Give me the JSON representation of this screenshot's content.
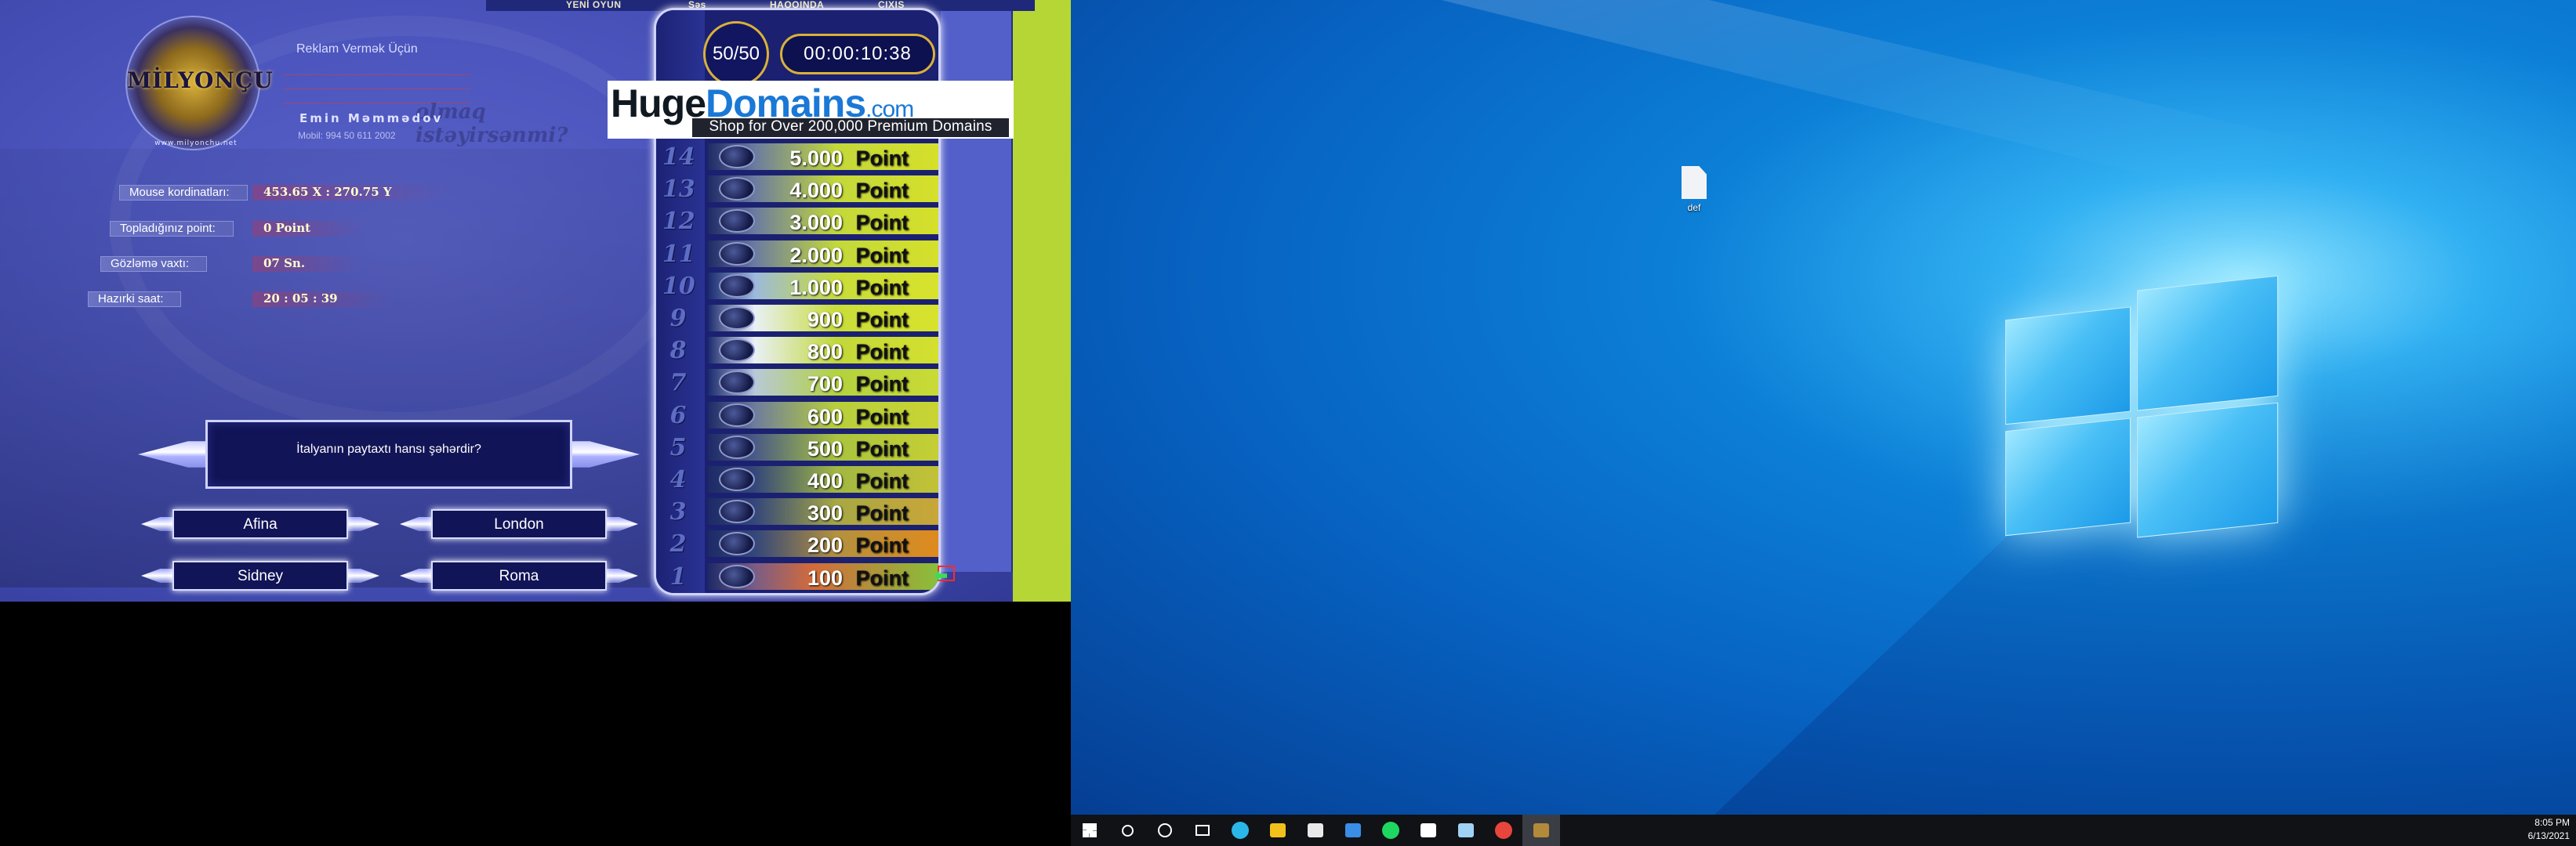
{
  "game": {
    "menu": {
      "new_game": "YENİ OYUN",
      "sound": "Səs",
      "about": "HAQQINDA",
      "exit": "ÇIXIŞ"
    },
    "logo": {
      "text": "MİLYONÇU",
      "site": "www.milyonchu.net"
    },
    "ad": {
      "title": "Reklam Vermək Üçün",
      "faint": "olmaq istəyirsənmi?",
      "name": "Emin Məmmədov",
      "phone": "Mobil: 994 50 611 2002"
    },
    "stats": [
      {
        "label": "Mouse kordinatları:",
        "value": "453.65 X : 270.75 Y"
      },
      {
        "label": "Topladığınız point:",
        "value": "0 Point"
      },
      {
        "label": "Gözləmə vaxtı:",
        "value": "07 Sn."
      },
      {
        "label": "Hazırki saat:",
        "value": "20 : 05 : 39"
      }
    ],
    "question": "İtalyanın paytaxtı hansı şəhərdir?",
    "answers": [
      "Afina",
      "London",
      "Sidney",
      "Roma"
    ],
    "lifeline": "50/50",
    "timer": "00:00:10:38",
    "ladder_unit": "Point",
    "ladder": [
      {
        "level": "14",
        "value": "5.000"
      },
      {
        "level": "13",
        "value": "4.000"
      },
      {
        "level": "12",
        "value": "3.000"
      },
      {
        "level": "11",
        "value": "2.000"
      },
      {
        "level": "10",
        "value": "1.000"
      },
      {
        "level": "9",
        "value": "900"
      },
      {
        "level": "8",
        "value": "800"
      },
      {
        "level": "7",
        "value": "700"
      },
      {
        "level": "6",
        "value": "600"
      },
      {
        "level": "5",
        "value": "500"
      },
      {
        "level": "4",
        "value": "400"
      },
      {
        "level": "3",
        "value": "300"
      },
      {
        "level": "2",
        "value": "200"
      },
      {
        "level": "1",
        "value": "100"
      }
    ],
    "banner": {
      "brand_a": "Huge",
      "brand_b": "Domains",
      "brand_c": ".com",
      "tagline": "Shop for Over 200,000 Premium Domains"
    }
  },
  "desktop": {
    "file_label": "def",
    "taskbar": {
      "items": [
        "start-icon",
        "search-icon",
        "cortana-icon",
        "task-view-icon",
        "edge-icon",
        "file-explorer-icon",
        "store-icon",
        "mail-icon",
        "spotify-icon",
        "settings-icon",
        "notepad-icon",
        "chrome-icon",
        "game-app-icon"
      ],
      "time": "8:05 PM",
      "date": "6/13/2021"
    }
  },
  "colors": {
    "game_bg": "#4b55bd",
    "green_strip": "#b6d636",
    "gold": "#d9b13a",
    "desktop_blue": "#0c7fd6",
    "taskbar": "#101215"
  }
}
